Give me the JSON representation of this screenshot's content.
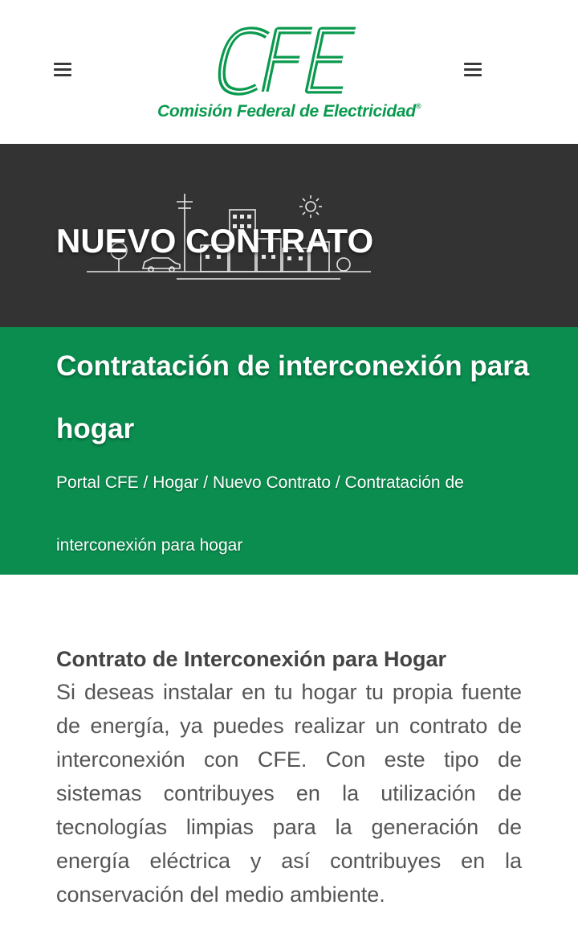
{
  "header": {
    "logo_mark": "CFE",
    "logo_text": "Comisión Federal de Electricidad",
    "logo_registered": "®",
    "menu_left_icon": "hamburger-menu-icon",
    "menu_right_icon": "hamburger-menu-icon"
  },
  "hero": {
    "title": "NUEVO CONTRATO"
  },
  "banner": {
    "title": "Contratación de interconexión para hogar",
    "breadcrumb": [
      {
        "label": "Portal CFE"
      },
      {
        "label": "Hogar"
      },
      {
        "label": "Nuevo Contrato"
      },
      {
        "label": "Contratación de interconexión para hogar"
      }
    ],
    "separator": " / "
  },
  "content": {
    "heading": "Contrato de Interconexión para Hogar",
    "paragraph": "Si deseas instalar en tu hogar tu propia fuente de energía, ya puedes realizar un contrato de interconexión con CFE. Con este tipo de sistemas contribuyes en la utilización de tecnologías limpias para la generación de energía eléctrica y así contribuyes en la conservación del medio ambiente."
  },
  "colors": {
    "brand_green": "#0a9a4e",
    "banner_green": "#0a8d4f",
    "hero_dark": "#333333",
    "text_dark": "#444444"
  }
}
